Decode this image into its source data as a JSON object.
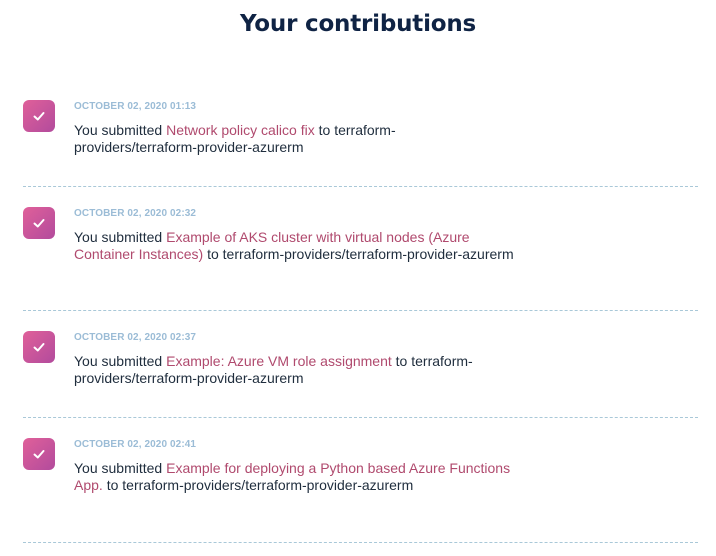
{
  "page": {
    "title": "Your contributions"
  },
  "colors": {
    "title": "#0f2344",
    "timestamp": "#9bbcd6",
    "link": "#b04a6e",
    "badge_start": "#e0609a",
    "badge_end": "#b24b9c",
    "divider": "#a9c8d8"
  },
  "contributions": [
    {
      "icon": "check-icon",
      "timestamp": "OCTOBER 02, 2020 01:13",
      "prefix": "You submitted ",
      "link_text": "Network policy calico fix",
      "connector": " to ",
      "repo": "terraform-providers/terraform-provider-azurerm"
    },
    {
      "icon": "check-icon",
      "timestamp": "OCTOBER 02, 2020 02:32",
      "prefix": "You submitted ",
      "link_text": "Example of AKS cluster with virtual nodes (Azure Container Instances)",
      "connector": " to ",
      "repo": "terraform-providers/terraform-provider-azurerm"
    },
    {
      "icon": "check-icon",
      "timestamp": "OCTOBER 02, 2020 02:37",
      "prefix": "You submitted ",
      "link_text": "Example: Azure VM role assignment",
      "connector": " to ",
      "repo": "terraform-providers/terraform-provider-azurerm"
    },
    {
      "icon": "check-icon",
      "timestamp": "OCTOBER 02, 2020 02:41",
      "prefix": "You submitted ",
      "link_text": "Example for deploying a Python based Azure Functions App.",
      "connector": " to ",
      "repo": "terraform-providers/terraform-provider-azurerm"
    }
  ]
}
